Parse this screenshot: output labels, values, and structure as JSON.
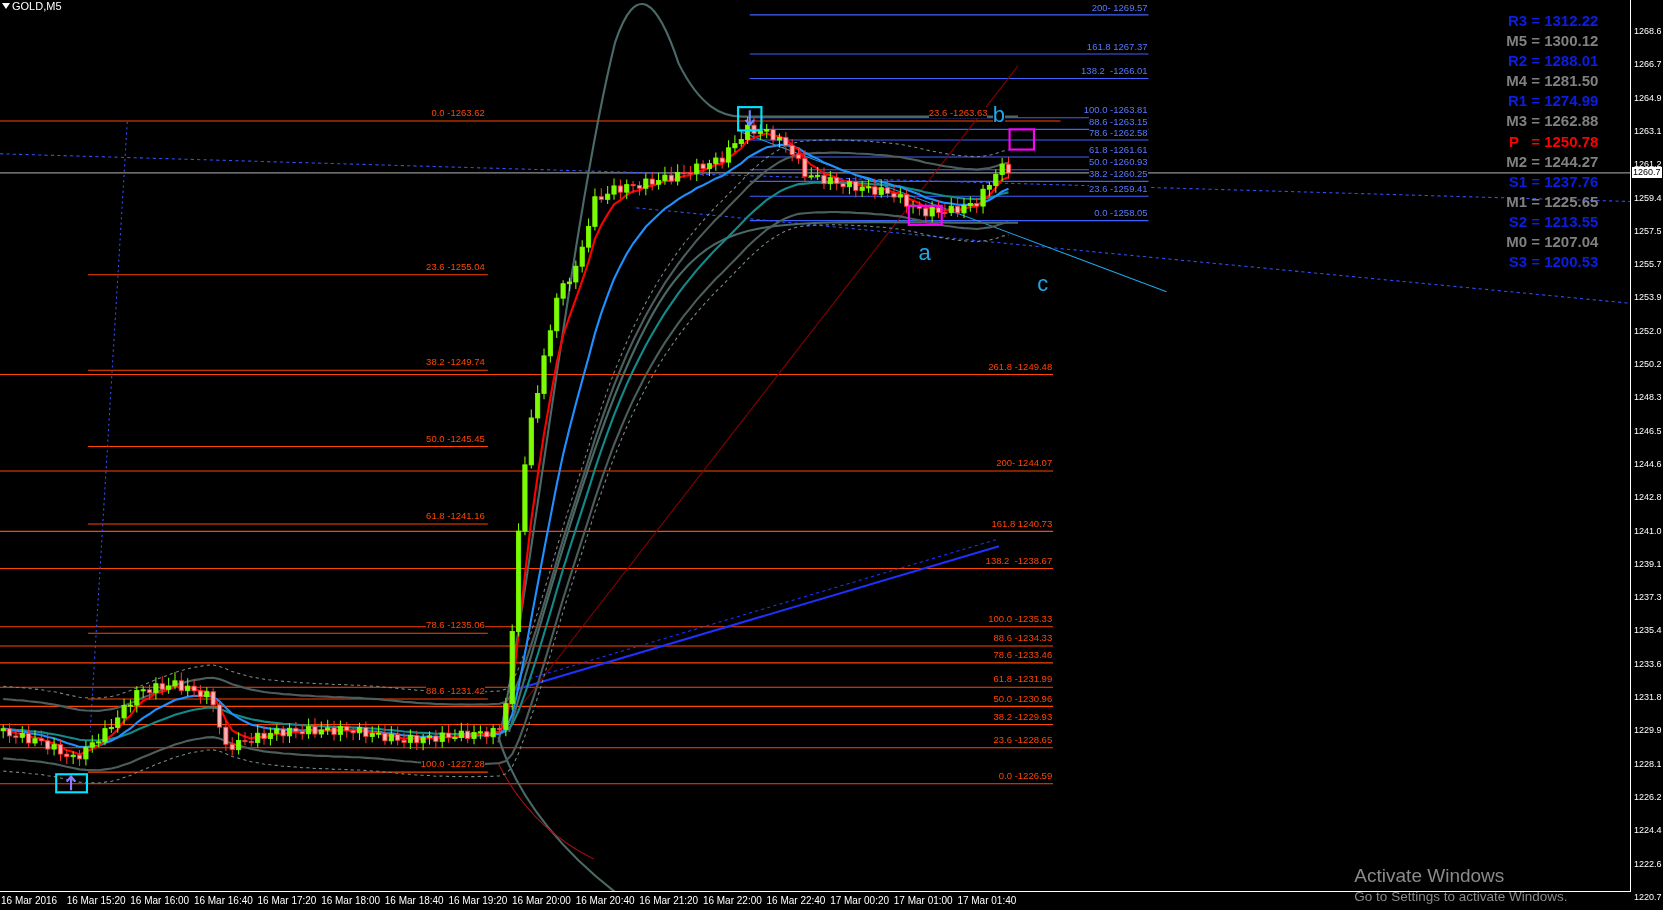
{
  "chart": {
    "title": "GOLD,M5",
    "price_axis": [
      "1268.6",
      "1266.7",
      "1264.9",
      "1263.1",
      "1261.2",
      "1259.4",
      "1257.5",
      "1255.7",
      "1253.9",
      "1252.0",
      "1250.2",
      "1248.3",
      "1246.5",
      "1244.6",
      "1242.8",
      "1241.0",
      "1239.1",
      "1237.3",
      "1235.4",
      "1233.6",
      "1231.8",
      "1229.9",
      "1228.1",
      "1226.2",
      "1224.4",
      "1222.6",
      "1220.7"
    ],
    "current_price": "1260.7",
    "time_axis": [
      "16 Mar 2016",
      "16 Mar 15:20",
      "16 Mar 16:00",
      "16 Mar 16:40",
      "16 Mar 17:20",
      "16 Mar 18:00",
      "16 Mar 18:40",
      "16 Mar 19:20",
      "16 Mar 20:00",
      "16 Mar 20:40",
      "16 Mar 21:20",
      "16 Mar 22:00",
      "16 Mar 22:40",
      "17 Mar 00:20",
      "17 Mar 01:00",
      "17 Mar 01:40"
    ],
    "fib_left": [
      "0.0 -1263.62",
      "23.6 -1255.04",
      "38.2 -1249.74",
      "50.0 -1245.45",
      "61.8 -1241.16",
      "78.6 -1235.06",
      "88.6 -1231.42",
      "100.0 -1227.28"
    ],
    "fib_right": [
      "23.6 -1263.63",
      "261.8 -1249.48",
      "200- 1244.07",
      "161.8 1240.73",
      "138.2  -1238.67",
      "100.0 -1235.33",
      "88.6 -1234.33",
      "78.6 -1233.46",
      "61.8 -1231.99",
      "50.0 -1230.96",
      "38.2 -1229.93",
      "23.6 -1228.65",
      "0.0 -1226.59"
    ],
    "fib_blue": [
      "200- 1269.57",
      "161.8 1267.37",
      "138.2  -1266.01",
      "100.0 -1263.81",
      "88.6 -1263.15",
      "78.6 -1262.58",
      "61.8 -1261.61",
      "50.0 -1260.93",
      "38.2 -1260.25",
      "23.6 -1259.41",
      "0.0 -1258.05"
    ],
    "wave_labels": [
      "a",
      "b",
      "c"
    ],
    "pivots": [
      {
        "label": "R3 = 1312.22",
        "color": "#0a1ee6"
      },
      {
        "label": "M5 = 1300.12",
        "color": "#808080"
      },
      {
        "label": "R2 = 1288.01",
        "color": "#0a1ee6"
      },
      {
        "label": "M4 = 1281.50",
        "color": "#808080"
      },
      {
        "label": "R1 = 1274.99",
        "color": "#0a1ee6"
      },
      {
        "label": "M3 = 1262.88",
        "color": "#808080"
      },
      {
        "label": "P   = 1250.78",
        "color": "#ff0000"
      },
      {
        "label": "M2 = 1244.27",
        "color": "#808080"
      },
      {
        "label": "S1 = 1237.76",
        "color": "#0a1ee6"
      },
      {
        "label": "M1 = 1225.65",
        "color": "#808080"
      },
      {
        "label": "S2 = 1213.55",
        "color": "#0a1ee6"
      },
      {
        "label": "M0 = 1207.04",
        "color": "#808080"
      },
      {
        "label": "S3 = 1200.53",
        "color": "#0a1ee6"
      }
    ]
  },
  "os_notice": {
    "title": "Activate Windows",
    "message": "Go to Settings to activate Windows."
  }
}
